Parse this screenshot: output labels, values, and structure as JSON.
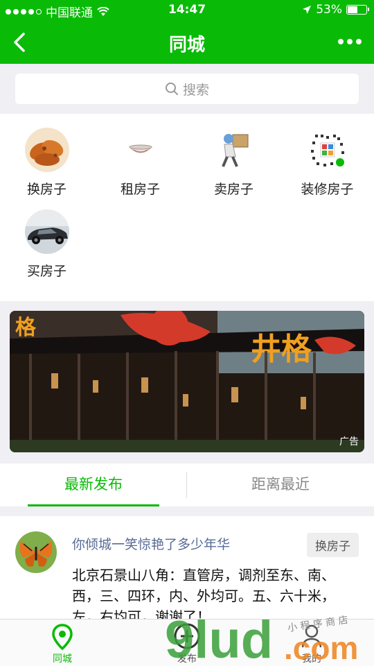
{
  "status_bar": {
    "carrier": "中国联通",
    "time": "14:47",
    "battery": "53%",
    "battery_level": 0.53
  },
  "nav": {
    "title": "同城",
    "back_icon": "chevron-left-icon",
    "more_icon": "more-dots-icon"
  },
  "search": {
    "placeholder": "搜索",
    "icon": "search-icon"
  },
  "categories": [
    {
      "label": "换房子",
      "icon": "chicken-wings-image"
    },
    {
      "label": "租房子",
      "icon": "bowl-image"
    },
    {
      "label": "卖房子",
      "icon": "delivery-man-image"
    },
    {
      "label": "装修房子",
      "icon": "qr-code-image"
    },
    {
      "label": "买房子",
      "icon": "car-image"
    }
  ],
  "banner": {
    "ad_label": "广告",
    "sign_text": "井格"
  },
  "tabs": [
    {
      "label": "最新发布",
      "active": true
    },
    {
      "label": "距离最近",
      "active": false
    }
  ],
  "post": {
    "author": "你倾城一笑惊艳了多少年华",
    "tag": "换房子",
    "content": "北京石景山八角：直管房，调剂至东、南、西，三、四环，内、外均可。五、六十米，左，右均可，谢谢了！"
  },
  "tabbar": [
    {
      "label": "同城",
      "icon": "location-pin-icon",
      "active": true
    },
    {
      "label": "发布",
      "icon": "plus-circle-icon"
    },
    {
      "label": "我的",
      "icon": "user-icon"
    }
  ],
  "watermark": {
    "domain": "9lud.com",
    "subtext": "小程序商店"
  },
  "colors": {
    "accent": "#09bb07",
    "link": "#576b95",
    "background": "#efeff4"
  }
}
